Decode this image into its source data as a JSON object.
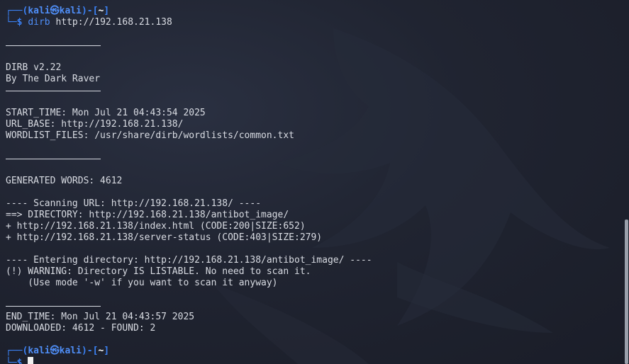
{
  "prompt1": {
    "top": "┌──(",
    "user": "kali",
    "at": "㉿",
    "host": "kali",
    "mid": ")-[",
    "dir": "~",
    "end": "]",
    "bottom": "└─",
    "dollar": "$",
    "command": "dirb",
    "argument": "http://192.168.21.138"
  },
  "output": {
    "banner_version": "DIRB v2.22",
    "banner_author": "By The Dark Raver",
    "start_time": "START_TIME: Mon Jul 21 04:43:54 2025",
    "url_base": "URL_BASE: http://192.168.21.138/",
    "wordlist": "WORDLIST_FILES: /usr/share/dirb/wordlists/common.txt",
    "generated": "GENERATED WORDS: 4612",
    "scanning": "---- Scanning URL: http://192.168.21.138/ ----",
    "directory": "==> DIRECTORY: http://192.168.21.138/antibot_image/",
    "hit1": "+ http://192.168.21.138/index.html (CODE:200|SIZE:652)",
    "hit2": "+ http://192.168.21.138/server-status (CODE:403|SIZE:279)",
    "entering": "---- Entering directory: http://192.168.21.138/antibot_image/ ----",
    "warning": "(!) WARNING: Directory IS LISTABLE. No need to scan it.",
    "warning_hint": "    (Use mode '-w' if you want to scan it anyway)",
    "end_time": "END_TIME: Mon Jul 21 04:43:57 2025",
    "summary": "DOWNLOADED: 4612 - FOUND: 2"
  },
  "prompt2": {
    "top": "┌──(",
    "user": "kali",
    "at": "㉿",
    "host": "kali",
    "mid": ")-[",
    "dir": "~",
    "end": "]",
    "bottom": "└─",
    "dollar": "$"
  }
}
